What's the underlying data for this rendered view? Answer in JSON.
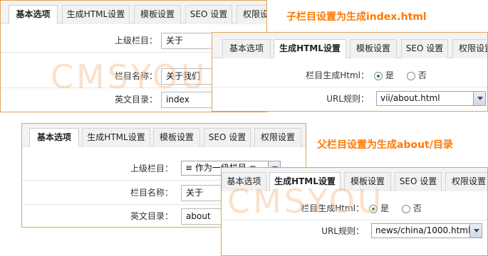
{
  "captions": {
    "top": "子栏目设置为生成index.html",
    "bottom": "父栏目设置为生成about/目录"
  },
  "watermark": "CMSYOU",
  "tabs": {
    "basic": "基本选项",
    "html": "生成HTML设置",
    "template": "模板设置",
    "seo": "SEO 设置",
    "perm": "权限设置"
  },
  "form_top": {
    "parent_label": "上级栏目：",
    "parent_value": "关于",
    "name_label": "栏目名称：",
    "name_value": "关于我们",
    "dir_label": "英文目录：",
    "dir_value": "index"
  },
  "html_top": {
    "gen_label": "栏目生成Html：",
    "yes": "是",
    "no": "否",
    "url_label": "URL规则：",
    "url_value": "vii/about.html"
  },
  "form_bottom": {
    "parent_label": "上级栏目：",
    "parent_value": "≡ 作为一级栏目 ≡",
    "name_label": "栏目名称：",
    "name_value": "关于",
    "dir_label": "英文目录：",
    "dir_value": "about"
  },
  "html_bottom": {
    "gen_label": "栏目生成Html：",
    "yes": "是",
    "no": "否",
    "url_label": "URL规则：",
    "url_value": "news/china/1000.html"
  },
  "colors": {
    "caption": "#ff7a00",
    "panel_border": "#e2a35a",
    "watermark": "#f6c9a3"
  }
}
